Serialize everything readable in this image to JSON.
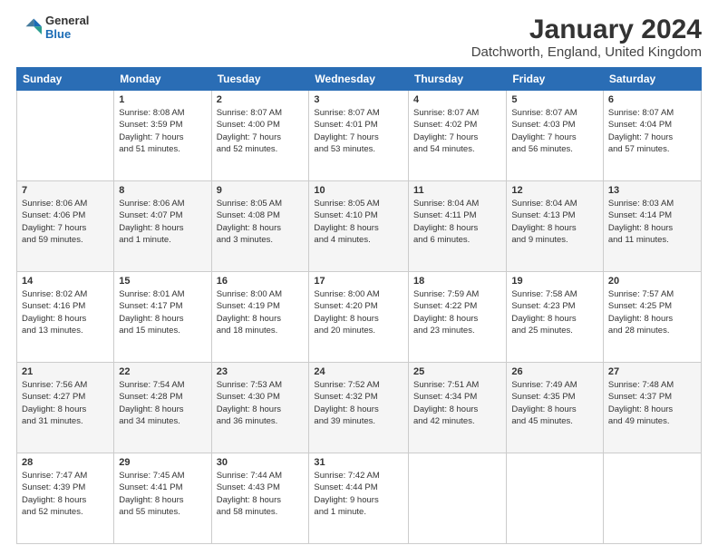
{
  "header": {
    "logo_general": "General",
    "logo_blue": "Blue",
    "month_title": "January 2024",
    "location": "Datchworth, England, United Kingdom"
  },
  "weekdays": [
    "Sunday",
    "Monday",
    "Tuesday",
    "Wednesday",
    "Thursday",
    "Friday",
    "Saturday"
  ],
  "weeks": [
    [
      {
        "day": "",
        "info": ""
      },
      {
        "day": "1",
        "info": "Sunrise: 8:08 AM\nSunset: 3:59 PM\nDaylight: 7 hours\nand 51 minutes."
      },
      {
        "day": "2",
        "info": "Sunrise: 8:07 AM\nSunset: 4:00 PM\nDaylight: 7 hours\nand 52 minutes."
      },
      {
        "day": "3",
        "info": "Sunrise: 8:07 AM\nSunset: 4:01 PM\nDaylight: 7 hours\nand 53 minutes."
      },
      {
        "day": "4",
        "info": "Sunrise: 8:07 AM\nSunset: 4:02 PM\nDaylight: 7 hours\nand 54 minutes."
      },
      {
        "day": "5",
        "info": "Sunrise: 8:07 AM\nSunset: 4:03 PM\nDaylight: 7 hours\nand 56 minutes."
      },
      {
        "day": "6",
        "info": "Sunrise: 8:07 AM\nSunset: 4:04 PM\nDaylight: 7 hours\nand 57 minutes."
      }
    ],
    [
      {
        "day": "7",
        "info": "Sunrise: 8:06 AM\nSunset: 4:06 PM\nDaylight: 7 hours\nand 59 minutes."
      },
      {
        "day": "8",
        "info": "Sunrise: 8:06 AM\nSunset: 4:07 PM\nDaylight: 8 hours\nand 1 minute."
      },
      {
        "day": "9",
        "info": "Sunrise: 8:05 AM\nSunset: 4:08 PM\nDaylight: 8 hours\nand 3 minutes."
      },
      {
        "day": "10",
        "info": "Sunrise: 8:05 AM\nSunset: 4:10 PM\nDaylight: 8 hours\nand 4 minutes."
      },
      {
        "day": "11",
        "info": "Sunrise: 8:04 AM\nSunset: 4:11 PM\nDaylight: 8 hours\nand 6 minutes."
      },
      {
        "day": "12",
        "info": "Sunrise: 8:04 AM\nSunset: 4:13 PM\nDaylight: 8 hours\nand 9 minutes."
      },
      {
        "day": "13",
        "info": "Sunrise: 8:03 AM\nSunset: 4:14 PM\nDaylight: 8 hours\nand 11 minutes."
      }
    ],
    [
      {
        "day": "14",
        "info": "Sunrise: 8:02 AM\nSunset: 4:16 PM\nDaylight: 8 hours\nand 13 minutes."
      },
      {
        "day": "15",
        "info": "Sunrise: 8:01 AM\nSunset: 4:17 PM\nDaylight: 8 hours\nand 15 minutes."
      },
      {
        "day": "16",
        "info": "Sunrise: 8:00 AM\nSunset: 4:19 PM\nDaylight: 8 hours\nand 18 minutes."
      },
      {
        "day": "17",
        "info": "Sunrise: 8:00 AM\nSunset: 4:20 PM\nDaylight: 8 hours\nand 20 minutes."
      },
      {
        "day": "18",
        "info": "Sunrise: 7:59 AM\nSunset: 4:22 PM\nDaylight: 8 hours\nand 23 minutes."
      },
      {
        "day": "19",
        "info": "Sunrise: 7:58 AM\nSunset: 4:23 PM\nDaylight: 8 hours\nand 25 minutes."
      },
      {
        "day": "20",
        "info": "Sunrise: 7:57 AM\nSunset: 4:25 PM\nDaylight: 8 hours\nand 28 minutes."
      }
    ],
    [
      {
        "day": "21",
        "info": "Sunrise: 7:56 AM\nSunset: 4:27 PM\nDaylight: 8 hours\nand 31 minutes."
      },
      {
        "day": "22",
        "info": "Sunrise: 7:54 AM\nSunset: 4:28 PM\nDaylight: 8 hours\nand 34 minutes."
      },
      {
        "day": "23",
        "info": "Sunrise: 7:53 AM\nSunset: 4:30 PM\nDaylight: 8 hours\nand 36 minutes."
      },
      {
        "day": "24",
        "info": "Sunrise: 7:52 AM\nSunset: 4:32 PM\nDaylight: 8 hours\nand 39 minutes."
      },
      {
        "day": "25",
        "info": "Sunrise: 7:51 AM\nSunset: 4:34 PM\nDaylight: 8 hours\nand 42 minutes."
      },
      {
        "day": "26",
        "info": "Sunrise: 7:49 AM\nSunset: 4:35 PM\nDaylight: 8 hours\nand 45 minutes."
      },
      {
        "day": "27",
        "info": "Sunrise: 7:48 AM\nSunset: 4:37 PM\nDaylight: 8 hours\nand 49 minutes."
      }
    ],
    [
      {
        "day": "28",
        "info": "Sunrise: 7:47 AM\nSunset: 4:39 PM\nDaylight: 8 hours\nand 52 minutes."
      },
      {
        "day": "29",
        "info": "Sunrise: 7:45 AM\nSunset: 4:41 PM\nDaylight: 8 hours\nand 55 minutes."
      },
      {
        "day": "30",
        "info": "Sunrise: 7:44 AM\nSunset: 4:43 PM\nDaylight: 8 hours\nand 58 minutes."
      },
      {
        "day": "31",
        "info": "Sunrise: 7:42 AM\nSunset: 4:44 PM\nDaylight: 9 hours\nand 1 minute."
      },
      {
        "day": "",
        "info": ""
      },
      {
        "day": "",
        "info": ""
      },
      {
        "day": "",
        "info": ""
      }
    ]
  ]
}
